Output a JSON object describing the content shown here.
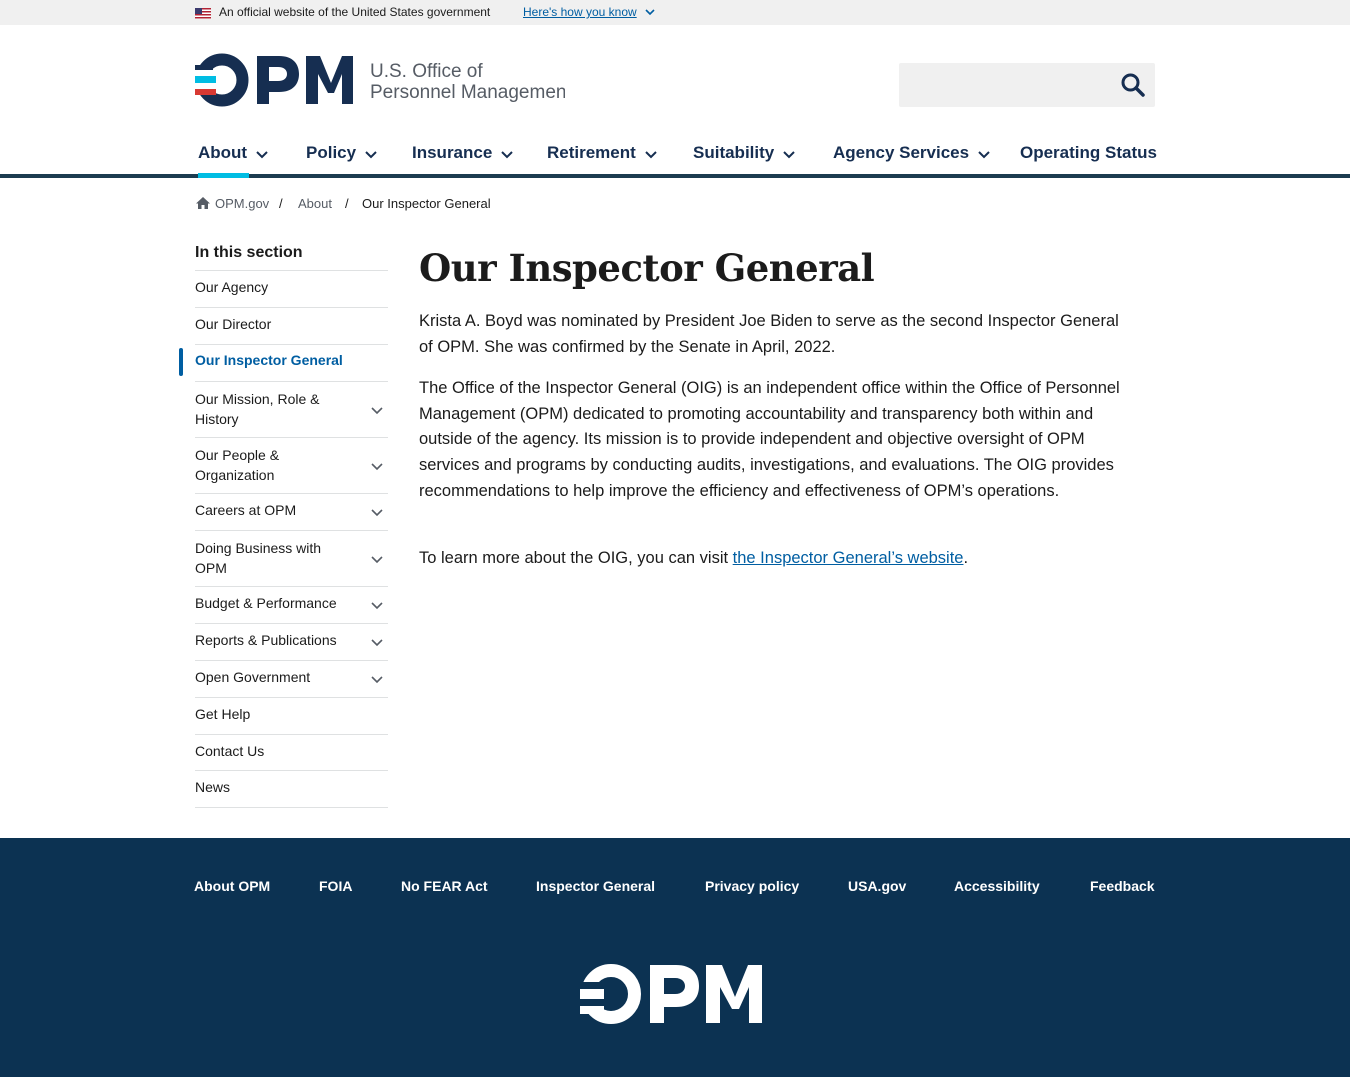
{
  "gov_banner": {
    "official_text": "An official website of the United States government",
    "how_link": "Here's how you know"
  },
  "logo": {
    "mark": "OPM",
    "line1": "U.S. Office of",
    "line2": "Personnel Management"
  },
  "search": {
    "placeholder": ""
  },
  "nav": {
    "items": [
      {
        "label": "About",
        "has_dropdown": true,
        "active": true
      },
      {
        "label": "Policy",
        "has_dropdown": true
      },
      {
        "label": "Insurance",
        "has_dropdown": true
      },
      {
        "label": "Retirement",
        "has_dropdown": true
      },
      {
        "label": "Suitability",
        "has_dropdown": true
      },
      {
        "label": "Agency Services",
        "has_dropdown": true
      },
      {
        "label": "Operating Status",
        "has_dropdown": false
      }
    ]
  },
  "breadcrumb": {
    "items": [
      "OPM.gov",
      "About",
      "Our Inspector General"
    ],
    "separator": "/"
  },
  "sidenav": {
    "heading": "In this section",
    "items": [
      {
        "label": "Our Agency",
        "expandable": false
      },
      {
        "label": "Our Director",
        "expandable": false
      },
      {
        "label": "Our Inspector General",
        "expandable": false,
        "current": true
      },
      {
        "label": "Our Mission, Role & History",
        "expandable": true
      },
      {
        "label": "Our People & Organization",
        "expandable": true
      },
      {
        "label": "Careers at OPM",
        "expandable": true
      },
      {
        "label": "Doing Business with OPM",
        "expandable": true
      },
      {
        "label": "Budget & Performance",
        "expandable": true
      },
      {
        "label": "Reports & Publications",
        "expandable": true
      },
      {
        "label": "Open Government",
        "expandable": true
      },
      {
        "label": "Get Help",
        "expandable": false
      },
      {
        "label": "Contact Us",
        "expandable": false
      },
      {
        "label": "News",
        "expandable": false
      }
    ]
  },
  "main": {
    "title": "Our Inspector General",
    "paragraph1": "Krista A. Boyd was nominated by President Joe Biden to serve as the second Inspector General of OPM. She was confirmed by the Senate in April, 2022.",
    "paragraph2": "The Office of the Inspector General (OIG) is an independent office within the Office of Personnel Management (OPM) dedicated to promoting accountability and transparency both within and outside of the agency. Its mission is to provide independent and objective oversight of OPM services and programs by conducting audits, investigations, and evaluations. The OIG provides recommendations to help improve the efficiency and effectiveness of OPM’s operations.",
    "paragraph3_prefix": "To learn more about the OIG, you can visit ",
    "paragraph3_link": "the Inspector General’s website",
    "paragraph3_suffix": "."
  },
  "footer": {
    "links": [
      "About OPM",
      "FOIA",
      "No FEAR Act",
      "Inspector General",
      "Privacy policy",
      "USA.gov",
      "Accessibility",
      "Feedback"
    ],
    "logo_mark": "OPM"
  },
  "colors": {
    "primary_navy": "#162e51",
    "link_blue": "#005ea2",
    "footer_bg": "#0c3252",
    "accent_red": "#d83933",
    "accent_cyan": "#00bde3",
    "gray_bg": "#f0f0f0"
  },
  "icons": {
    "flag": "us-flag-icon",
    "chevron": "chevron-down-icon",
    "search": "search-icon",
    "home": "home-icon"
  }
}
